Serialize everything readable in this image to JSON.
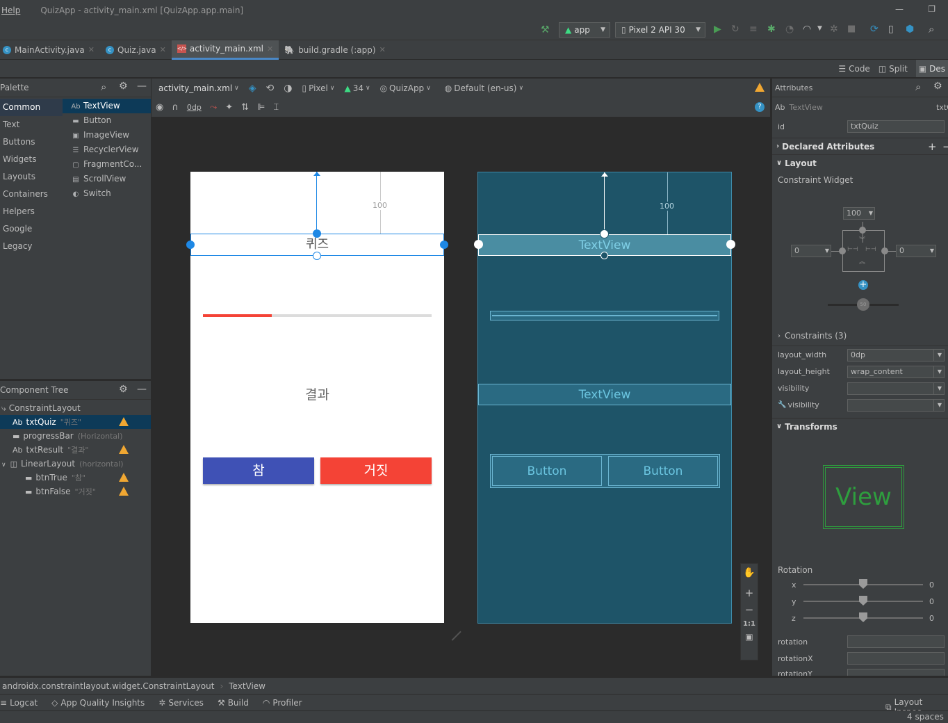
{
  "window": {
    "menu_help": "Help",
    "title": "QuizApp - activity_main.xml [QuizApp.app.main]",
    "minimize": "—",
    "restore": "❐"
  },
  "toolbar": {
    "run_config": "app",
    "device": "Pixel 2 API 30"
  },
  "tabs": [
    {
      "label": "MainActivity.java",
      "icon": "C"
    },
    {
      "label": "Quiz.java",
      "icon": "C"
    },
    {
      "label": "activity_main.xml",
      "icon": "xml"
    },
    {
      "label": "build.gradle (:app)",
      "icon": "gradle"
    }
  ],
  "view_modes": {
    "code": "Code",
    "split": "Split",
    "design": "Des"
  },
  "palette": {
    "title": "Palette",
    "categories": [
      "Common",
      "Text",
      "Buttons",
      "Widgets",
      "Layouts",
      "Containers",
      "Helpers",
      "Google",
      "Legacy"
    ],
    "items": [
      {
        "icon": "Ab",
        "label": "TextView"
      },
      {
        "icon": "▬",
        "label": "Button"
      },
      {
        "icon": "▣",
        "label": "ImageView"
      },
      {
        "icon": "☰",
        "label": "RecyclerView"
      },
      {
        "icon": "▢",
        "label": "FragmentCo..."
      },
      {
        "icon": "▤",
        "label": "ScrollView"
      },
      {
        "icon": "◐",
        "label": "Switch"
      }
    ]
  },
  "component_tree": {
    "title": "Component Tree",
    "nodes": [
      {
        "label": "ConstraintLayout",
        "sub": "",
        "icon": "⤷"
      },
      {
        "label": "txtQuiz",
        "sub": "\"퀴즈\"",
        "icon": "Ab"
      },
      {
        "label": "progressBar",
        "sub": "(Horizontal)",
        "icon": "▬"
      },
      {
        "label": "txtResult",
        "sub": "\"결과\"",
        "icon": "Ab"
      },
      {
        "label": "LinearLayout",
        "sub": "(horizontal)",
        "icon": "◫"
      },
      {
        "label": "btnTrue",
        "sub": "\"참\"",
        "icon": "▬"
      },
      {
        "label": "btnFalse",
        "sub": "\"거짓\"",
        "icon": "▬"
      }
    ]
  },
  "design_toolbar": {
    "file": "activity_main.xml",
    "margin": "0dp",
    "device": "Pixel",
    "api": "34",
    "theme": "QuizApp",
    "locale": "Default (en-us)"
  },
  "design": {
    "quiz_text": "퀴즈",
    "result_text": "결과",
    "true_button": "참",
    "false_button": "거짓",
    "margin_label": "100",
    "progress": 0.3,
    "true_color": "#3f51b5",
    "false_color": "#f44336"
  },
  "blueprint": {
    "text1": "TextView",
    "text2": "TextView",
    "button1": "Button",
    "button2": "Button",
    "margin_label": "100"
  },
  "zoom": {
    "fit": "1:1"
  },
  "attributes": {
    "title": "Attributes",
    "widget_type": "TextView",
    "widget_id_short": "txtQ",
    "id_label": "id",
    "id_value": "txtQuiz",
    "declared": "Declared Attributes",
    "layout": "Layout",
    "constraint_widget": "Constraint Widget",
    "top_margin": "100",
    "left_margin": "0",
    "right_margin": "0",
    "bias": "50",
    "constraints": "Constraints (3)",
    "layout_width_label": "layout_width",
    "layout_width": "0dp",
    "layout_height_label": "layout_height",
    "layout_height": "wrap_content",
    "visibility_label": "visibility",
    "visibility_tools_label": "visibility",
    "transforms": "Transforms",
    "view_preview": "View",
    "rotation_label": "Rotation",
    "rot_x": "x",
    "rot_y": "y",
    "rot_z": "z",
    "rot_x_val": "0",
    "rot_y_val": "0",
    "rot_z_val": "0",
    "rotation": "rotation",
    "rotationX": "rotationX",
    "rotationY": "rotationY"
  },
  "breadcrumb": [
    "androidx.constraintlayout.widget.ConstraintLayout",
    "TextView"
  ],
  "bottom_tools": [
    "Logcat",
    "App Quality Insights",
    "Services",
    "Build",
    "Profiler"
  ],
  "layout_inspector": "Layout Inspec",
  "status": "4 spaces"
}
